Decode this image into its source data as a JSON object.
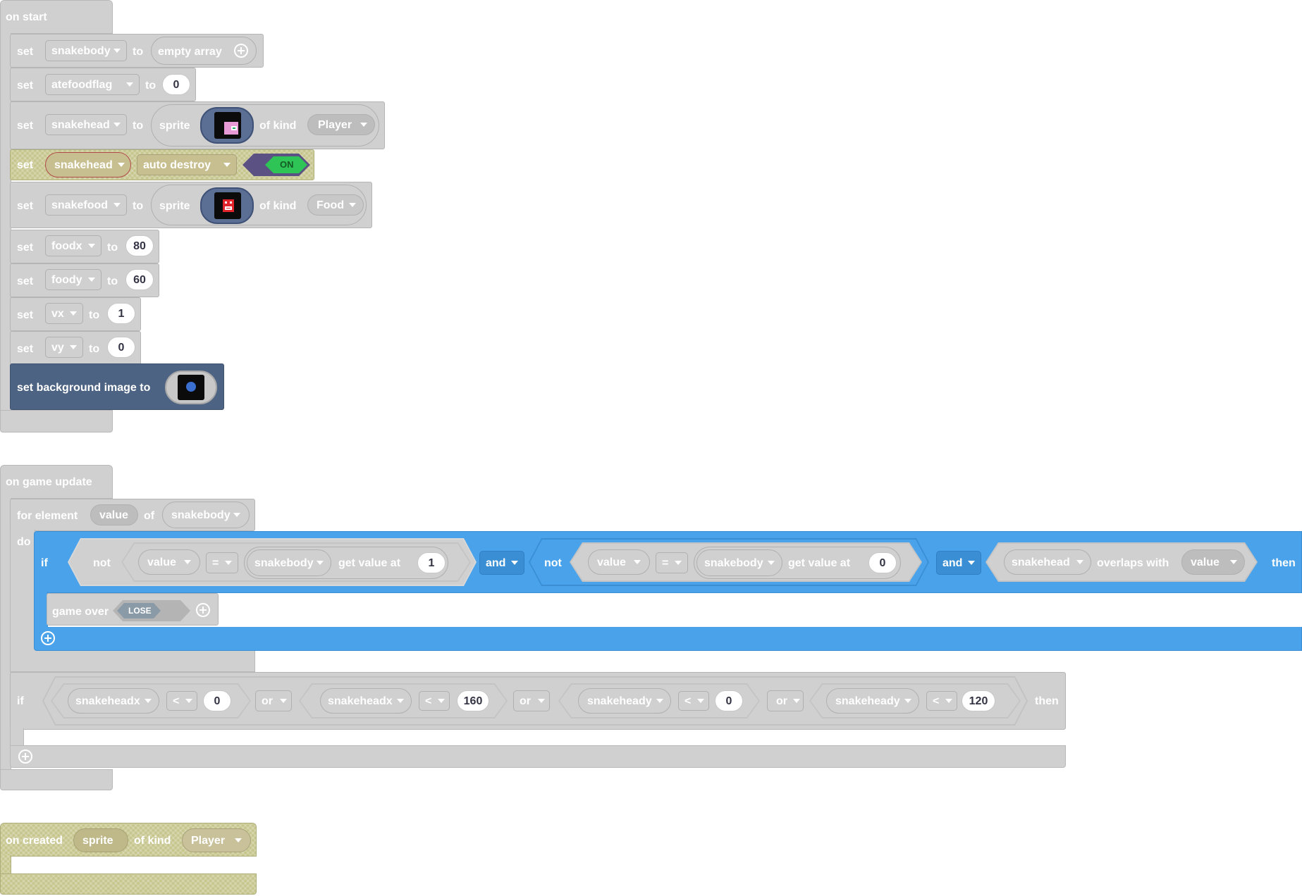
{
  "colors": {
    "block_gray": "#d0d0d0",
    "olive_block": "#c6c58c",
    "scene_block": "#4d6383",
    "if_blue": "#4aa3ea",
    "on_green": "#2ec456",
    "number_slot_bg": "#ffffff"
  },
  "on_start": {
    "header": "on start",
    "rows": [
      {
        "set": "set",
        "variable": "snakebody",
        "to": "to",
        "value": "empty array"
      },
      {
        "set": "set",
        "variable": "atefoodflag",
        "to": "to",
        "value": "0"
      },
      {
        "set": "set",
        "variable": "snakehead",
        "to": "to",
        "sprite": "sprite",
        "of_kind": "of kind",
        "kind": "Player"
      },
      {
        "set": "set",
        "variable": "snakehead",
        "property": "auto destroy",
        "toggle": "ON"
      },
      {
        "set": "set",
        "variable": "snakefood",
        "to": "to",
        "sprite": "sprite",
        "of_kind": "of kind",
        "kind": "Food"
      },
      {
        "set": "set",
        "variable": "foodx",
        "to": "to",
        "value": "80"
      },
      {
        "set": "set",
        "variable": "foody",
        "to": "to",
        "value": "60"
      },
      {
        "set": "set",
        "variable": "vx",
        "to": "to",
        "value": "1"
      },
      {
        "set": "set",
        "variable": "vy",
        "to": "to",
        "value": "0"
      }
    ],
    "background": "set background image to"
  },
  "on_game_update": {
    "header": "on game update",
    "for_element": "for element",
    "for_var": "value",
    "of": "of",
    "for_array": "snakebody",
    "do": "do",
    "if1": {
      "if": "if",
      "cond1": {
        "not": "not",
        "left": "value",
        "op": "=",
        "array": "snakebody",
        "get": "get value at",
        "index": "1"
      },
      "and1": "and",
      "cond2": {
        "not": "not",
        "left": "value",
        "op": "=",
        "array": "snakebody",
        "get": "get value at",
        "index": "0"
      },
      "and2": "and",
      "cond3": {
        "sprite": "snakehead",
        "overlaps": "overlaps with",
        "other": "value"
      },
      "then": "then",
      "body": {
        "game_over": "game over",
        "lose": "LOSE"
      }
    },
    "if2": {
      "if": "if",
      "c1": {
        "var": "snakeheadx",
        "op": "<",
        "val": "0"
      },
      "or1": "or",
      "c2": {
        "var": "snakeheadx",
        "op": "<",
        "val": "160"
      },
      "or2": "or",
      "c3": {
        "var": "snakeheady",
        "op": "<",
        "val": "0"
      },
      "or3": "or",
      "c4": {
        "var": "snakeheady",
        "op": "<",
        "val": "120"
      },
      "then": "then"
    }
  },
  "on_created": {
    "header": "on created",
    "var": "sprite",
    "of_kind": "of kind",
    "kind": "Player"
  }
}
